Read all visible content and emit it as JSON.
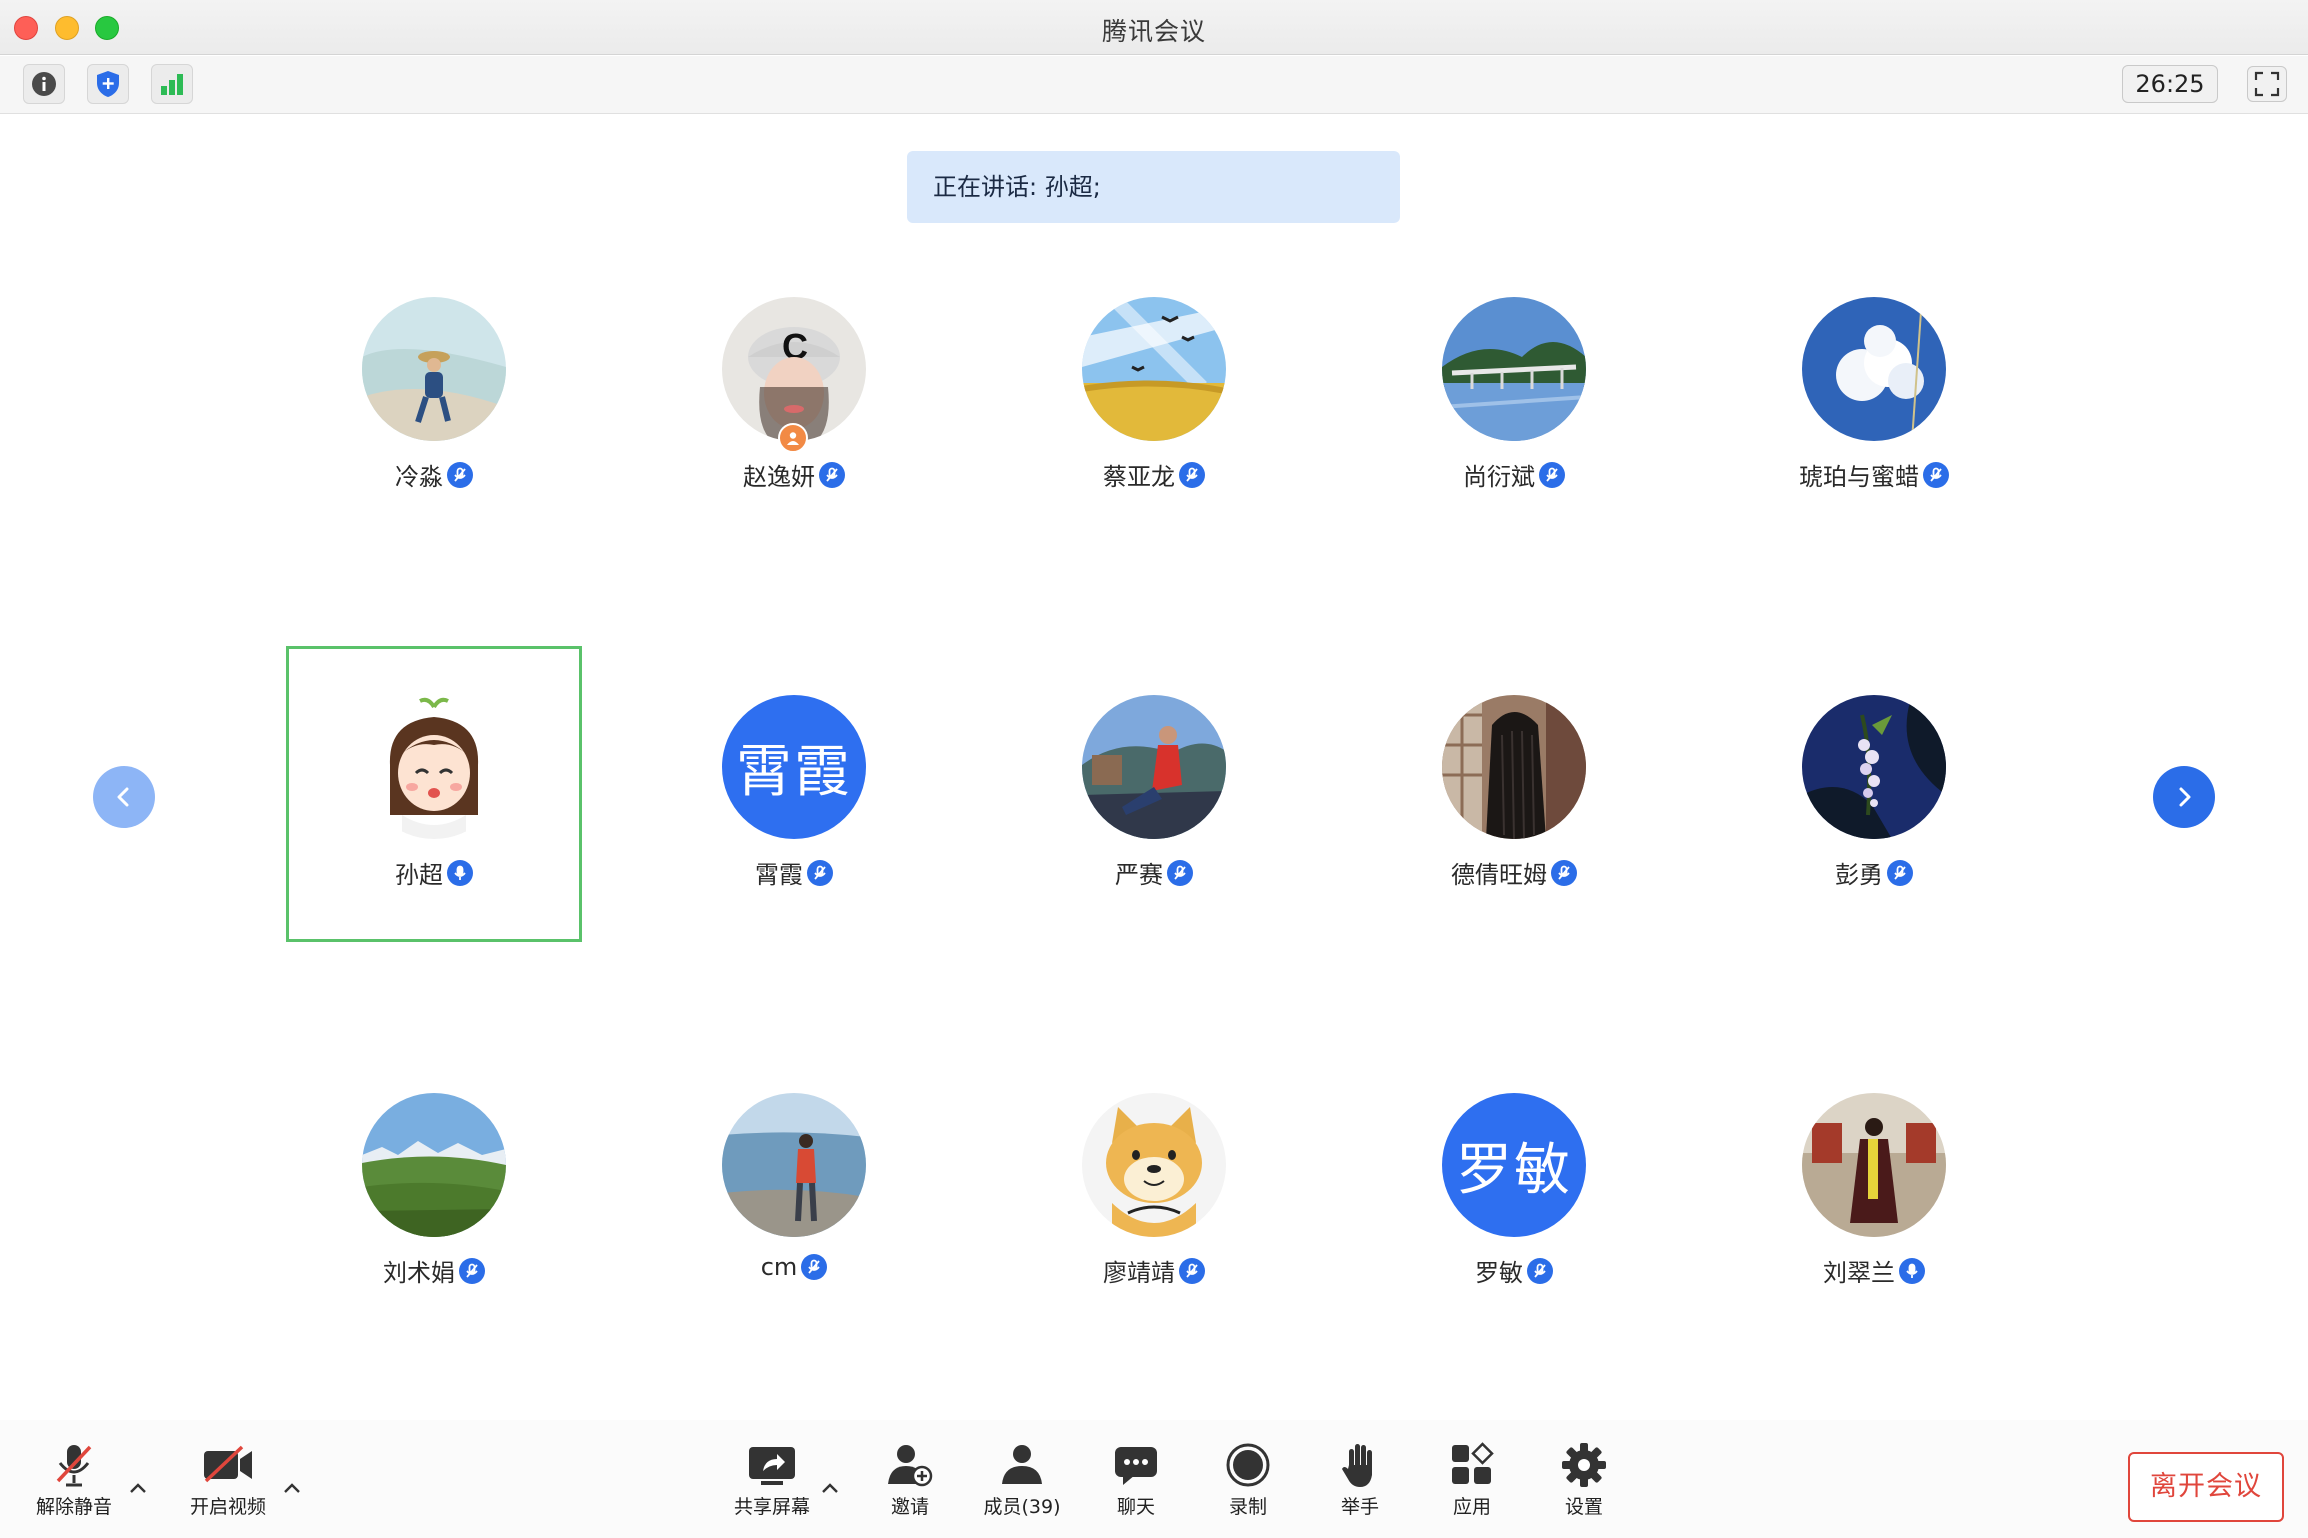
{
  "window": {
    "title": "腾讯会议"
  },
  "toolbar": {
    "timer": "26:25"
  },
  "banner": {
    "speaking": "正在讲话: 孙超;"
  },
  "participants": [
    {
      "name": "冷淼"
    },
    {
      "name": "赵逸妍"
    },
    {
      "name": "蔡亚龙"
    },
    {
      "name": "尚衍斌"
    },
    {
      "name": "琥珀与蜜蜡"
    },
    {
      "name": "孙超"
    },
    {
      "name": "霄霞",
      "avatar_text": "霄霞"
    },
    {
      "name": "严赛"
    },
    {
      "name": "德倩旺姆"
    },
    {
      "name": "彭勇"
    },
    {
      "name": "刘术娟"
    },
    {
      "name": "cm"
    },
    {
      "name": "廖靖靖"
    },
    {
      "name": "罗敏",
      "avatar_text": "罗敏"
    },
    {
      "name": "刘翠兰"
    }
  ],
  "bottombar": {
    "unmute": "解除静音",
    "start_video": "开启视频",
    "share_screen": "共享屏幕",
    "invite": "邀请",
    "members": "成员(39)",
    "chat": "聊天",
    "record": "录制",
    "raise_hand": "举手",
    "apps": "应用",
    "settings": "设置",
    "leave": "离开会议"
  },
  "colors": {
    "accent": "#2b6de8",
    "active_speaker_border": "#5ac26a",
    "leave": "#e0463c",
    "banner": "#d9e8fb"
  }
}
